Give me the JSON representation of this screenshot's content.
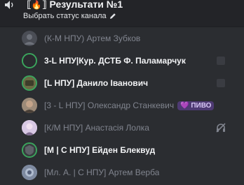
{
  "channel": {
    "name_prefix": "⟦",
    "emoji": "🔥",
    "name_suffix": "⟧ Результати №1",
    "status_prompt": "Выбрать статус канала"
  },
  "members": [
    {
      "name": "(К-М НПУ) Артем Зубков",
      "style": "dim"
    },
    {
      "name": "3-L НПУ|Кур. ДСТБ Ф. Паламарчук",
      "style": "bright"
    },
    {
      "name": "[L НПУ] Данило Іванович",
      "style": "bright"
    },
    {
      "name": "[3 - L НПУ] Олександр Станкевич",
      "style": "dim",
      "badge": "💜 ПИВО"
    },
    {
      "name": "[К/М НПУ] Анастасія Лолка",
      "style": "dim"
    },
    {
      "name": "[M | C НПУ] Ейден Блеквуд",
      "style": "bright"
    },
    {
      "name": "[Мл. А. | С НПУ] Артем Верба",
      "style": "dim"
    }
  ],
  "colors": {
    "background": "#2b2d31",
    "header": "#232428",
    "speaking_ring": "#3ba55d",
    "dim_text": "#80848e",
    "bright_text": "#f2f3f5"
  },
  "icons": {
    "channel": "speaker-icon",
    "status": "pencil-icon",
    "deafened": "headphones-muted-icon",
    "stream": "screen-icon"
  }
}
